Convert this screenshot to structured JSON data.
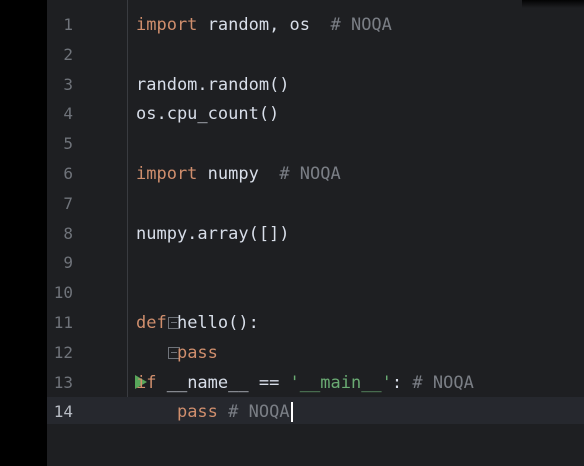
{
  "editor": {
    "lines": [
      {
        "number": "1",
        "tokens": [
          [
            "kw",
            "import"
          ],
          [
            "plain",
            " random, os  "
          ],
          [
            "comment",
            "# NOQA"
          ]
        ]
      },
      {
        "number": "2",
        "tokens": []
      },
      {
        "number": "3",
        "tokens": [
          [
            "plain",
            "random.random()"
          ]
        ]
      },
      {
        "number": "4",
        "tokens": [
          [
            "plain",
            "os.cpu_count()"
          ]
        ]
      },
      {
        "number": "5",
        "tokens": []
      },
      {
        "number": "6",
        "tokens": [
          [
            "kw",
            "import"
          ],
          [
            "plain",
            " numpy  "
          ],
          [
            "comment",
            "# NOQA"
          ]
        ]
      },
      {
        "number": "7",
        "tokens": []
      },
      {
        "number": "8",
        "tokens": [
          [
            "plain",
            "numpy.array([])"
          ]
        ]
      },
      {
        "number": "9",
        "tokens": []
      },
      {
        "number": "10",
        "tokens": []
      },
      {
        "number": "11",
        "tokens": [
          [
            "kw",
            "def"
          ],
          [
            "plain",
            " hello():"
          ]
        ]
      },
      {
        "number": "12",
        "tokens": [
          [
            "plain",
            "    "
          ],
          [
            "kw",
            "pass"
          ]
        ]
      },
      {
        "number": "13",
        "tokens": [
          [
            "kw",
            "if"
          ],
          [
            "plain",
            " __name__ == "
          ],
          [
            "str",
            "'__main__'"
          ],
          [
            "plain",
            ": "
          ],
          [
            "comment",
            "# NOQA"
          ]
        ]
      },
      {
        "number": "14",
        "tokens": [
          [
            "plain",
            "    "
          ],
          [
            "kw",
            "pass"
          ],
          [
            "plain",
            " "
          ],
          [
            "comment",
            "# NOQA"
          ]
        ]
      }
    ]
  },
  "gutter_icons": {
    "run_line": "13",
    "fold_start_line": "11",
    "fold_end_line": "12"
  },
  "colors": {
    "background": "#1e1f22",
    "keyword": "#cf8e6d",
    "comment": "#7a7e85",
    "string": "#6aab73",
    "run": "#57a65a"
  }
}
